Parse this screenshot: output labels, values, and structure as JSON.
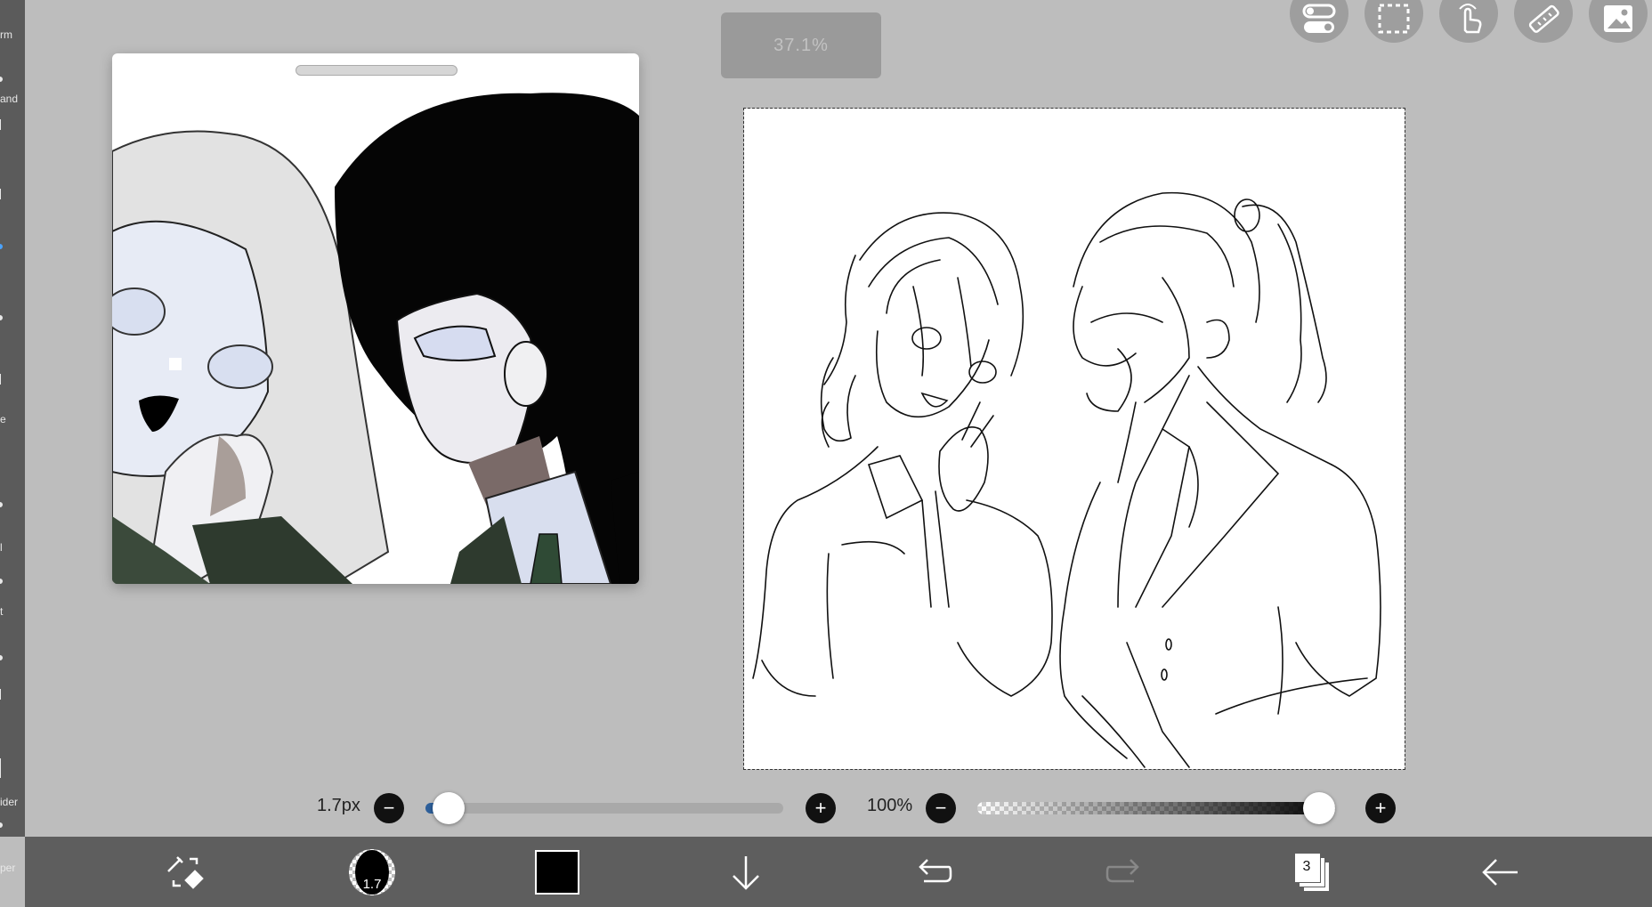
{
  "left_strip": {
    "labels": [
      "rm",
      "and",
      "e",
      "l",
      "t",
      "ider",
      "per"
    ]
  },
  "zoom_level": "37.1%",
  "top_buttons": [
    {
      "name": "toggle-settings-icon"
    },
    {
      "name": "selection-icon"
    },
    {
      "name": "hand-touch-icon"
    },
    {
      "name": "ruler-icon"
    },
    {
      "name": "image-icon"
    }
  ],
  "brush": {
    "size_label": "1.7px",
    "size_value_fraction": 0.02,
    "opacity_label": "100%",
    "opacity_value_fraction": 1.0,
    "minus": "−",
    "plus": "+"
  },
  "bottom_toolbar": {
    "brush_size_badge": "1.7",
    "layer_count": "3",
    "active_color": "#000000"
  },
  "colors": {
    "background": "#bdbdbd",
    "toolbar": "#5e5e5e",
    "accent": "#2d5f9a"
  }
}
